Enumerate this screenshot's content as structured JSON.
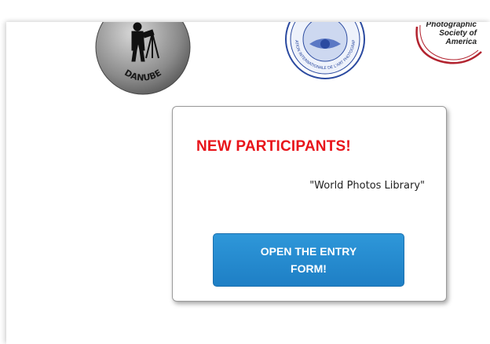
{
  "logos": {
    "danube": {
      "text": "DANUBE",
      "color": "#2a2a2a"
    },
    "fiap": {
      "text": "FEDERATION INTERNATIONALE DE L'ART PHOTOGRAPHIQUE",
      "color": "#1f3f96"
    },
    "psa": {
      "line1": "Photographic",
      "line2": "Society of",
      "line3": "America",
      "color": "#b2232f"
    }
  },
  "panel": {
    "headline": "NEW PARTICIPANTS!",
    "subtitle": "\"World Photos Library\"",
    "button_label": "OPEN THE ENTRY FORM!"
  },
  "colors": {
    "headline": "#e8141a",
    "button": "#2a8fd4"
  }
}
